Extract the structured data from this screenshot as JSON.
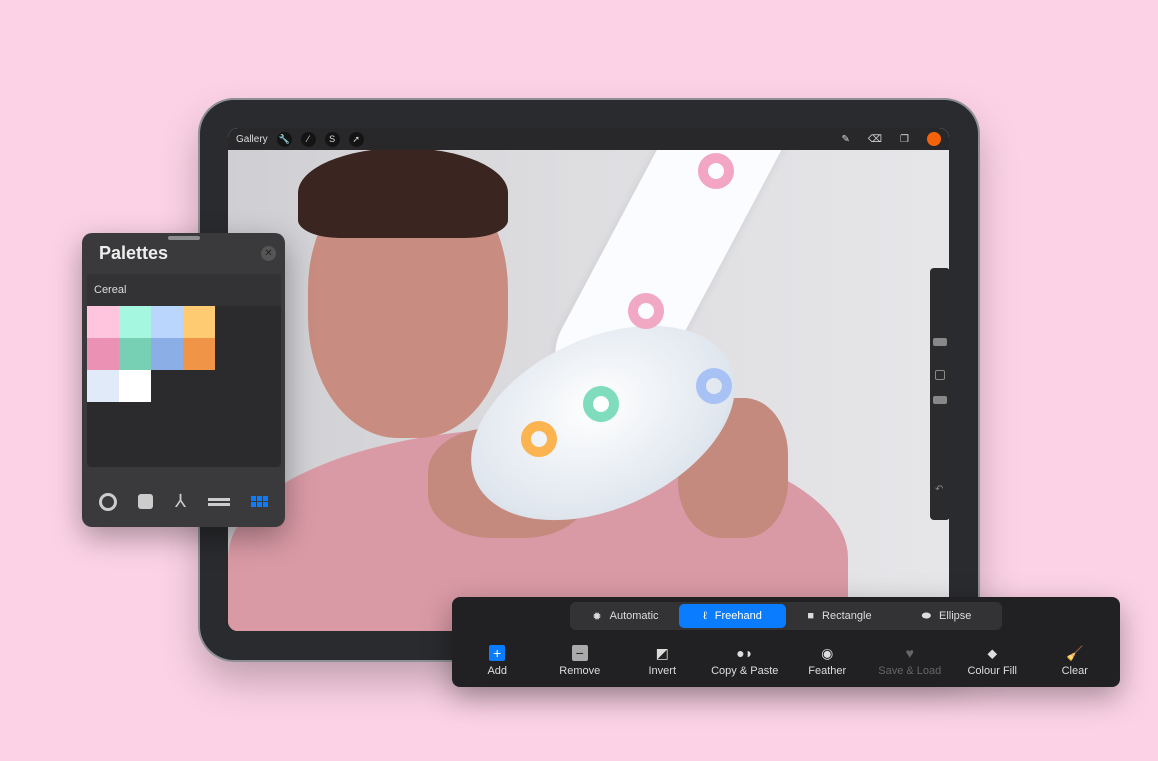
{
  "procreate": {
    "gallery_label": "Gallery",
    "left_tools": [
      {
        "icon": "wrench-icon",
        "glyph": "🔧"
      },
      {
        "icon": "magic-wand-icon",
        "glyph": "⁄"
      },
      {
        "icon": "selection-icon",
        "glyph": "S"
      },
      {
        "icon": "transform-icon",
        "glyph": "➚"
      }
    ],
    "current_color": "#f6620a"
  },
  "palettes": {
    "title": "Palettes",
    "palette_name": "Cereal",
    "swatches": [
      "#ffc4de",
      "#a5f7e0",
      "#bbd6fd",
      "#fecb73",
      "#ea91b4",
      "#77cfb4",
      "#8caee6",
      "#f09548",
      "#e0eaf8",
      "#ffffff"
    ],
    "tools": [
      "disc-icon",
      "classic-icon",
      "harmony-icon",
      "value-icon",
      "palettes-grid-icon"
    ],
    "accent": "#0a7cff"
  },
  "selection": {
    "modes": [
      {
        "label": "Automatic",
        "icon": "automatic-icon"
      },
      {
        "label": "Freehand",
        "icon": "freehand-icon",
        "active": true
      },
      {
        "label": "Rectangle",
        "icon": "rectangle-icon"
      },
      {
        "label": "Ellipse",
        "icon": "ellipse-icon"
      }
    ],
    "actions": [
      {
        "label": "Add",
        "icon": "add-icon",
        "glyph": "+"
      },
      {
        "label": "Remove",
        "icon": "remove-icon",
        "glyph": "−"
      },
      {
        "label": "Invert",
        "icon": "invert-icon",
        "glyph": "◩"
      },
      {
        "label": "Copy & Paste",
        "icon": "copy-paste-icon",
        "glyph": "●◗"
      },
      {
        "label": "Feather",
        "icon": "feather-icon",
        "glyph": "◉"
      },
      {
        "label": "Save & Load",
        "icon": "heart-icon",
        "glyph": "♥",
        "disabled": true
      },
      {
        "label": "Colour Fill",
        "icon": "colour-fill-icon",
        "glyph": "⬥"
      },
      {
        "label": "Clear",
        "icon": "clear-icon",
        "glyph": "🧹"
      }
    ]
  }
}
